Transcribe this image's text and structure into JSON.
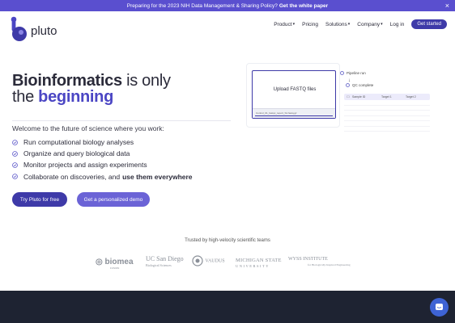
{
  "banner": {
    "text": "Preparing for the 2023 NIH Data Management & Sharing Policy?",
    "link": "Get the white paper",
    "close": "×"
  },
  "brand": {
    "name": "pluto"
  },
  "nav": {
    "items": [
      {
        "label": "Product",
        "dropdown": true
      },
      {
        "label": "Pricing",
        "dropdown": false
      },
      {
        "label": "Solutions",
        "dropdown": true
      },
      {
        "label": "Company",
        "dropdown": true
      },
      {
        "label": "Log in",
        "dropdown": false
      }
    ],
    "cta": "Get started"
  },
  "hero": {
    "title_bold_1": "Bioinformatics",
    "title_rest_1": " is only",
    "title_plain_2": "the ",
    "title_accent_2": "beginning",
    "intro": "Welcome to the future of science where you work:",
    "features": [
      "Run computational biology analyses",
      "Organize and query biological data",
      "Monitor projects and assign experiments",
      "Collaborate on discoveries, and"
    ],
    "feature_last_bold": "use them everywhere",
    "cta_primary": "Try Pluto for free",
    "cta_secondary": "Get a personalized demo"
  },
  "illustration": {
    "upload_label": "Upload FASTQ files",
    "file_row": "Control_01_fastqc_report_S1.fastq.gz",
    "pipeline_run": "Pipeline run",
    "qc_complete": "QC complete",
    "table_headers": [
      "Sample ID",
      "Target 1",
      "Target 2"
    ]
  },
  "trusted": {
    "label": "Trusted by high-velocity scientific teams",
    "logos": {
      "biomea": "biomea",
      "biomea_sub": "FUSION",
      "ucsd": "UC San Diego",
      "ucsd_sub": "Biological Sciences",
      "vaudus": "VAUDUS",
      "msu": "MICHIGAN STATE",
      "msu_sub": "UNIVERSITY",
      "wyss": "WYSS INSTITUTE",
      "wyss_sub": "for Biologically Inspired Engineering"
    }
  },
  "colors": {
    "brand": "#3e3aa8",
    "accent": "#4b46c4",
    "banner": "#5a4fcf",
    "secondary_cta": "#6b63d6",
    "footer": "#1e2332",
    "chat": "#3e63d4"
  },
  "icons": {
    "close": "close-icon",
    "chevron": "chevron-down-icon",
    "check": "check-circle-icon",
    "chat": "chat-bubble-icon"
  }
}
